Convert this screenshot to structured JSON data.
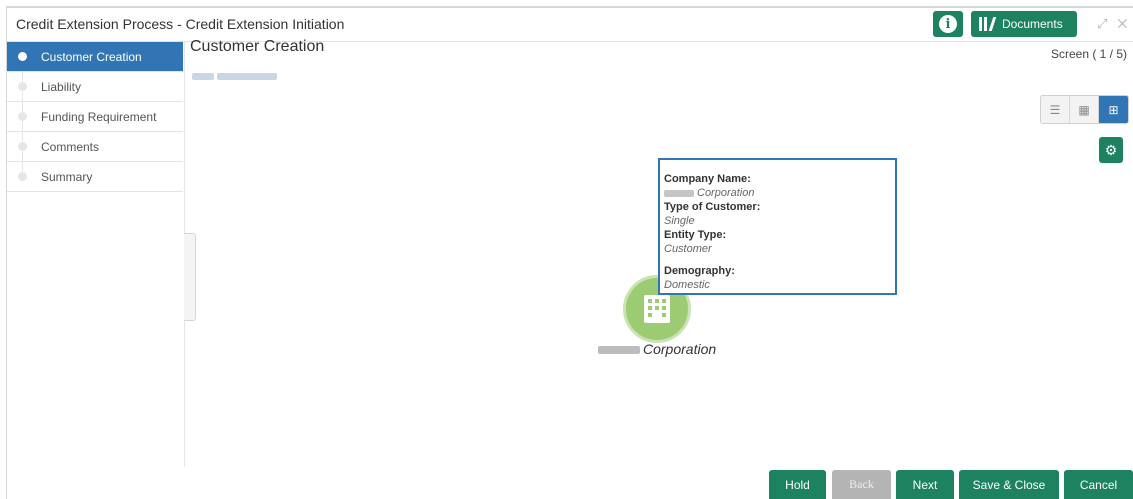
{
  "window": {
    "title": "Credit Extension Process - Credit Extension Initiation",
    "documents_label": "Documents"
  },
  "sidebar": {
    "items": [
      {
        "label": "Customer Creation",
        "active": true
      },
      {
        "label": "Liability",
        "active": false
      },
      {
        "label": "Funding Requirement",
        "active": false
      },
      {
        "label": "Comments",
        "active": false
      },
      {
        "label": "Summary",
        "active": false
      }
    ]
  },
  "main": {
    "title": "Customer Creation",
    "screen_count": "Screen ( 1 / 5)"
  },
  "node": {
    "label_suffix": "Corporation"
  },
  "tooltip": {
    "company_name_label": "Company Name:",
    "company_name_value": "Corporation",
    "type_label": "Type of Customer:",
    "type_value": "Single",
    "entity_label": "Entity Type:",
    "entity_value": "Customer",
    "demography_label": "Demography:",
    "demography_value": "Domestic"
  },
  "footer": {
    "hold": "Hold",
    "back": "Back",
    "next": "Next",
    "save_close": "Save & Close",
    "cancel": "Cancel"
  },
  "colors": {
    "primary_green": "#1c8260",
    "active_blue": "#3275b5",
    "node_green": "#9ccb73"
  }
}
